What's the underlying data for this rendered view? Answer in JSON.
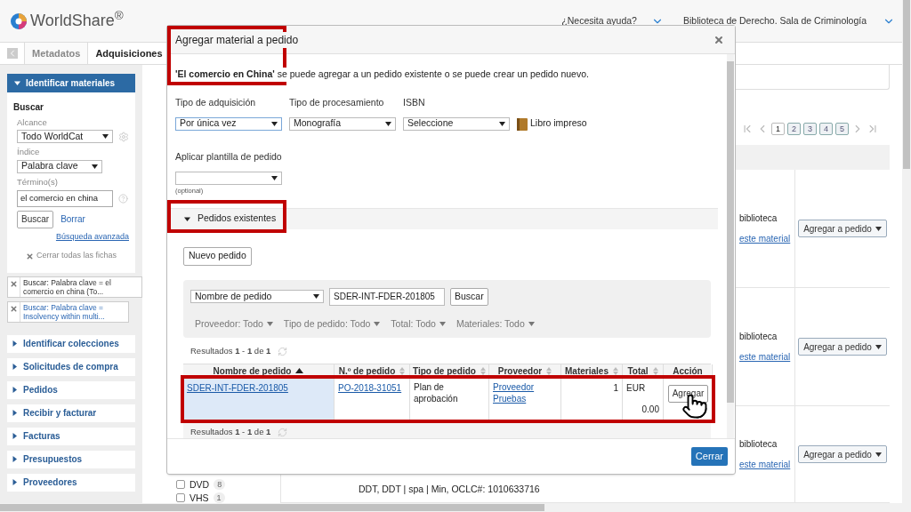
{
  "header": {
    "logo": "WorldShare$^{®}$",
    "help": "¿Necesita ayuda?",
    "library": "Biblioteca de Derecho. Sala de Criminología"
  },
  "tabs": [
    {
      "label": "Metadatos",
      "selected": false
    },
    {
      "label": "Adquisiciones",
      "selected": true
    }
  ],
  "sidebar": {
    "panel": {
      "title": "Identificar materiales",
      "expanded": true,
      "heading": "Buscar",
      "scope_label": "Alcance",
      "scope": "Todo WorldCat",
      "index_label": "Índice",
      "index": "Palabra clave",
      "terms_label": "Término(s)",
      "terms": "el comercio en china",
      "search_button": "Buscar",
      "clear_link": "Borrar",
      "advanced_link": "Búsqueda avanzada",
      "close_all": "Cerrar todas las fichas",
      "chips": [
        {
          "label": "Buscar: Palabra clave = el comercio en china (To...",
          "selected": true
        },
        {
          "label": "Buscar: Palabra clave = Insolvency within multi...",
          "selected": false
        }
      ]
    },
    "sections": [
      {
        "label": "Identificar colecciones",
        "expanded": false
      },
      {
        "label": "Solicitudes de compra",
        "expanded": false
      },
      {
        "label": "Pedidos",
        "expanded": false
      },
      {
        "label": "Recibir y facturar",
        "expanded": false
      },
      {
        "label": "Facturas",
        "expanded": false
      },
      {
        "label": "Presupuestos",
        "expanded": false
      },
      {
        "label": "Proveedores",
        "expanded": false
      }
    ]
  },
  "results": {
    "pages": [
      {
        "label": "1",
        "selected": true
      },
      {
        "label": "2",
        "selected": false
      },
      {
        "label": "3",
        "selected": false
      },
      {
        "label": "4",
        "selected": false
      },
      {
        "label": "5",
        "selected": false
      }
    ],
    "rows": [
      {
        "holding": "biblioteca",
        "link": "este material",
        "action": "Agregar a pedido"
      },
      {
        "holding": "biblioteca",
        "link": "este material",
        "action": "Agregar a pedido"
      },
      {
        "holding": "biblioteca",
        "link": "este material",
        "action": "Agregar a pedido"
      }
    ],
    "facets": [
      {
        "label": "DVD",
        "count": "8",
        "checked": false
      },
      {
        "label": "VHS",
        "count": "1",
        "checked": false
      }
    ],
    "record_details": "DDT, DDT | spa | Min, OCLC#: 1010633716"
  },
  "dialog": {
    "title": "Agregar material a pedido",
    "highlighted": true,
    "message": "**'El comercio en China'** se puede agregar a un pedido existente o se puede crear un pedido nuevo.",
    "fields": [
      {
        "label": "Tipo de adquisición",
        "value": "Por única vez",
        "focused": true
      },
      {
        "label": "Tipo de procesamiento",
        "value": "Monografía",
        "focused": false
      },
      {
        "label": "ISBN",
        "value": "Seleccione",
        "focused": false
      }
    ],
    "format": "Libro impreso",
    "template": {
      "label": "Aplicar plantilla de pedido",
      "note": "(optional)"
    },
    "existing": {
      "title": "Pedidos existentes",
      "expanded": true,
      "highlighted": true,
      "new_button": "Nuevo pedido",
      "search": {
        "field": "Nombre de pedido",
        "value": "SDER-INT-FDER-201805",
        "button": "Buscar"
      },
      "filters": [
        "Proveedor: Todo",
        "Tipo de pedido: Todo",
        "Total: Todo",
        "Materiales: Todo"
      ],
      "summary": "Resultados **1** - **1** de **1**",
      "columns": [
        {
          "label": "Nombre de pedido",
          "sortable": true,
          "sorted": true
        },
        {
          "label": "N.º de pedido",
          "sortable": true,
          "sorted": false
        },
        {
          "label": "Tipo de pedido",
          "sortable": true,
          "sorted": false
        },
        {
          "label": "Proveedor",
          "sortable": true,
          "sorted": false
        },
        {
          "label": "Materiales",
          "sortable": true,
          "sorted": false
        },
        {
          "label": "Total",
          "sortable": true,
          "sorted": false
        },
        {
          "label": "Acción",
          "sortable": false
        }
      ],
      "rows": [
        {
          "name": "SDER-INT-FDER-201805",
          "number": "PO-2018-31051",
          "type": "Plan de aprobación",
          "vendor": "Proveedor Pruebas",
          "items": "1",
          "currency": "EUR",
          "total": "0.00",
          "action": "Agregar",
          "selected": true,
          "highlighted": true
        }
      ],
      "footer_summary": "Resultados **1** - **1** de **1**"
    },
    "close_button": "Cerrar"
  }
}
